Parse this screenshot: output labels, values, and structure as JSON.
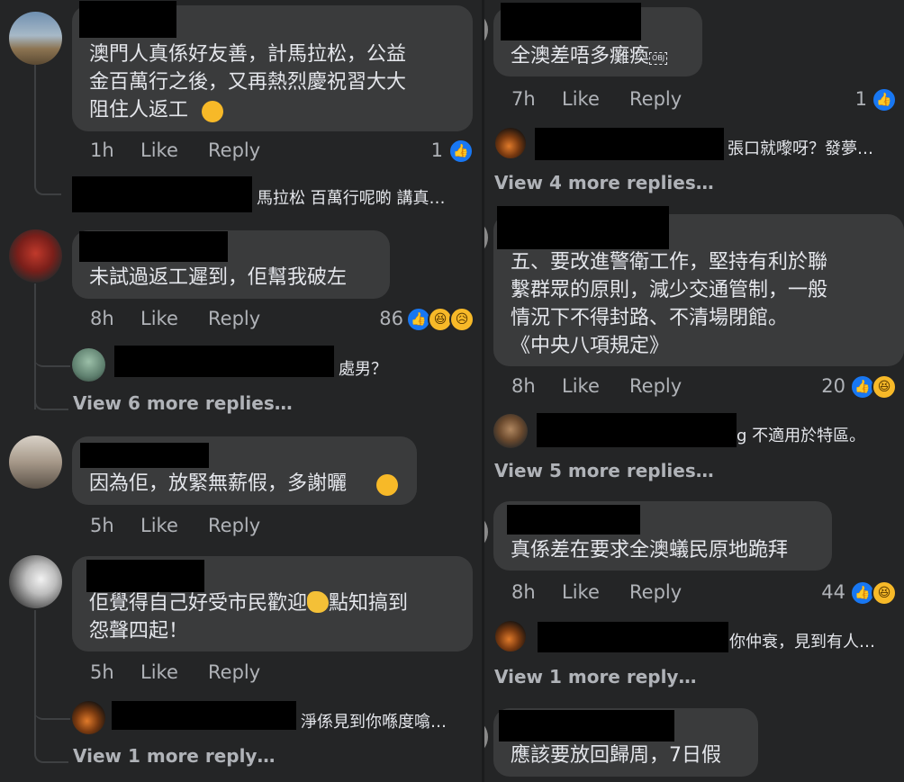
{
  "left": {
    "comments": [
      {
        "text": "澳門人真係好友善，計馬拉松，公益\n金百萬行之後，又再熱烈慶祝習大大\n阻住人返工",
        "time": "1h",
        "like": "Like",
        "reply": "Reply",
        "reaction_count": "1",
        "reactions": [
          "like"
        ],
        "reply_preview": "馬拉松 百萬行呢啲 講真…",
        "more_replies": ""
      },
      {
        "text": "未試過返工遲到，佢幫我破左",
        "time": "8h",
        "like": "Like",
        "reply": "Reply",
        "reaction_count": "86",
        "reactions": [
          "like",
          "haha",
          "sad"
        ],
        "reply_preview": "處男？",
        "more_replies": "View 6 more replies…"
      },
      {
        "text": "因為佢，放緊無薪假，多謝曬",
        "time": "5h",
        "like": "Like",
        "reply": "Reply",
        "reaction_count": "",
        "reactions": [],
        "reply_preview": "",
        "more_replies": ""
      },
      {
        "text": "佢覺得自己好受市民歡迎",
        "text2": "點知搞到\n怨聲四起！",
        "time": "5h",
        "like": "Like",
        "reply": "Reply",
        "reaction_count": "",
        "reactions": [],
        "reply_preview": "淨係見到你喺度噏…",
        "more_replies": "View 1 more reply…"
      }
    ]
  },
  "right": {
    "comments": [
      {
        "text": "全澳差唔多癱瘓",
        "obj": "OBJ",
        "time": "7h",
        "like": "Like",
        "reply": "Reply",
        "reaction_count": "1",
        "reactions": [
          "like"
        ],
        "reply_preview": "張口就嚟呀？發夢…",
        "more_replies": "View 4 more replies…"
      },
      {
        "text": "五、要改進警衛工作，堅持有利於聯\n繫群眾的原則，減少交通管制，一般\n情況下不得封路、不清場閉館。\n《中央八項規定》",
        "time": "8h",
        "like": "Like",
        "reply": "Reply",
        "reaction_count": "20",
        "reactions": [
          "like",
          "haha"
        ],
        "reply_preview": "g 不適用於特區。",
        "more_replies": "View 5 more replies…"
      },
      {
        "text": "真係差在要求全澳蟻民原地跪拜",
        "time": "8h",
        "like": "Like",
        "reply": "Reply",
        "reaction_count": "44",
        "reactions": [
          "like",
          "haha"
        ],
        "reply_preview": "你仲衰，見到有人…",
        "more_replies": "View 1 more reply…"
      },
      {
        "text": "應該要放回歸周，7日假",
        "time": "",
        "like": "",
        "reply": "",
        "reaction_count": "",
        "reactions": [],
        "reply_preview": "",
        "more_replies": ""
      }
    ]
  },
  "colors": {
    "bubble": "#3a3b3c",
    "background": "#242526",
    "meta": "#b0b3b8",
    "like_blue": "#1877f2",
    "emoji_yellow": "#f7b928"
  }
}
